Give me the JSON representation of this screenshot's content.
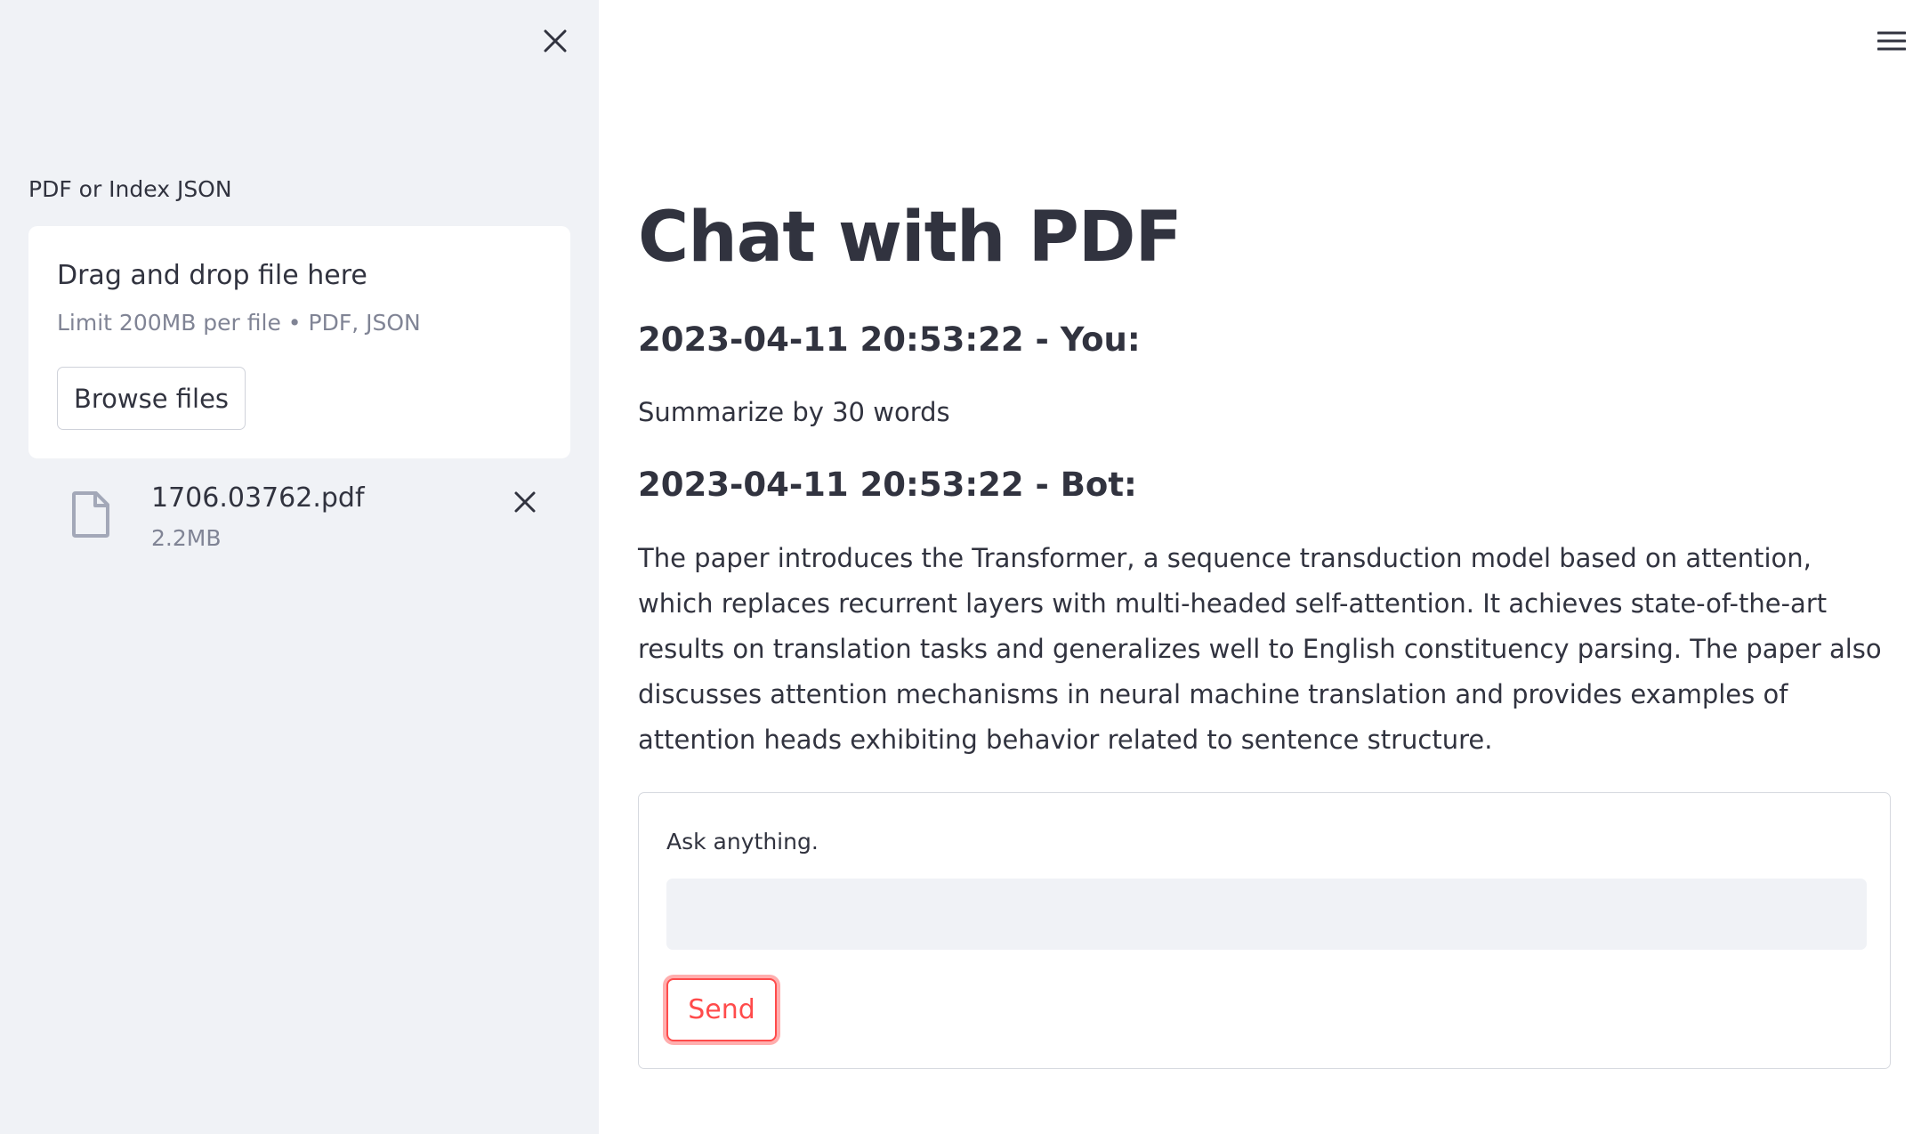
{
  "sidebar": {
    "close_icon": "close-icon",
    "uploader": {
      "label": "PDF or Index JSON",
      "drop_title": "Drag and drop file here",
      "limit_text": "Limit 200MB per file • PDF, JSON",
      "browse_label": "Browse files"
    },
    "file": {
      "icon": "file-icon",
      "name": "1706.03762.pdf",
      "size": "2.2MB",
      "remove_icon": "close-icon"
    }
  },
  "header": {
    "menu_icon": "hamburger-menu-icon"
  },
  "main": {
    "title": "Chat with PDF",
    "messages": [
      {
        "header": "2023-04-11 20:53:22 - You:",
        "text": "Summarize by 30 words"
      },
      {
        "header": "2023-04-11 20:53:22 - Bot:",
        "text": "The paper introduces the Transformer, a sequence transduction model based on attention, which replaces recurrent layers with multi-headed self-attention. It achieves state-of-the-art results on translation tasks and generalizes well to English constituency parsing. The paper also discusses attention mechanisms in neural machine translation and provides examples of attention heads exhibiting behavior related to sentence structure."
      }
    ],
    "form": {
      "label": "Ask anything.",
      "input_value": "",
      "send_label": "Send"
    }
  },
  "colors": {
    "sidebar_bg": "#f0f2f6",
    "text": "#31333f",
    "muted_text": "#808495",
    "accent": "#ff4b4b",
    "file_icon": "#a3a8b8"
  }
}
